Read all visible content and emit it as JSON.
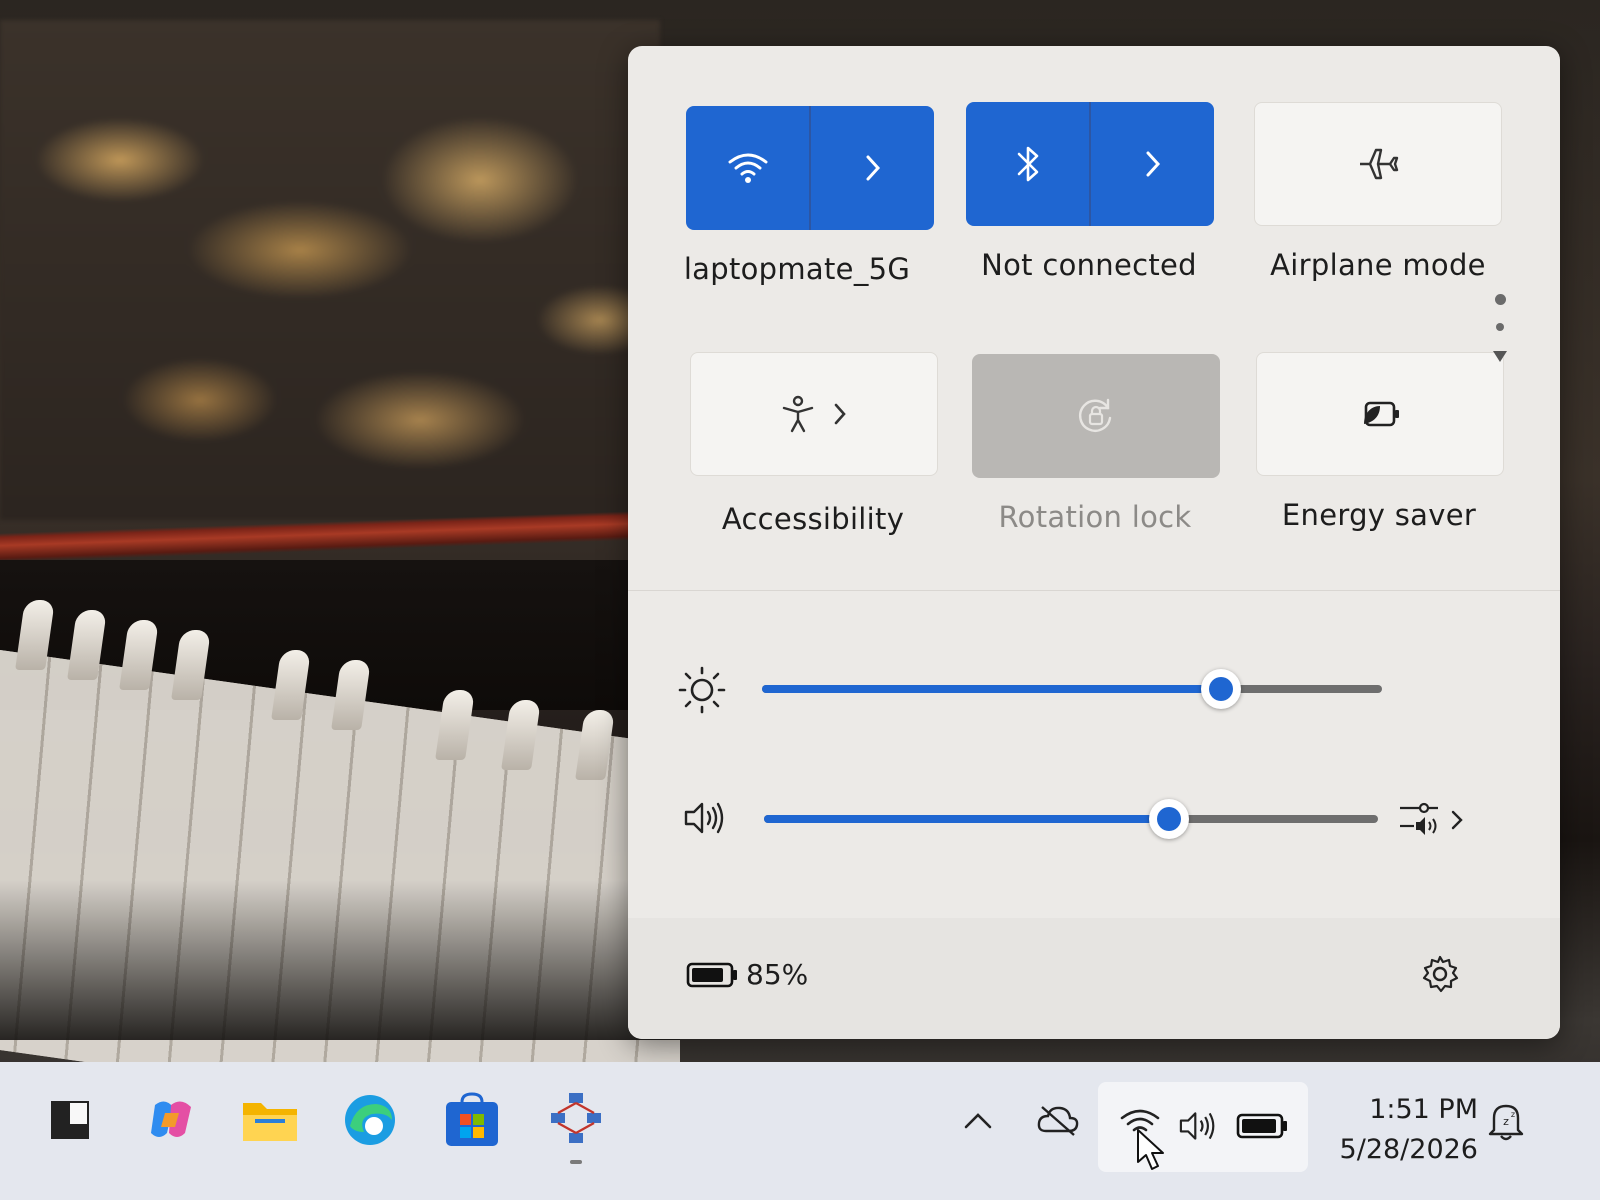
{
  "quick_settings": {
    "tiles": [
      {
        "id": "wifi",
        "label": "laptopmate_5G",
        "state": "on",
        "icon": "wifi-icon",
        "has_chevron": true
      },
      {
        "id": "bluetooth",
        "label": "Not connected",
        "state": "on",
        "icon": "bluetooth-icon",
        "has_chevron": true
      },
      {
        "id": "airplane",
        "label": "Airplane mode",
        "state": "off",
        "icon": "airplane-icon",
        "has_chevron": false
      },
      {
        "id": "accessibility",
        "label": "Accessibility",
        "state": "off",
        "icon": "accessibility-icon",
        "has_chevron": true
      },
      {
        "id": "rotation",
        "label": "Rotation lock",
        "state": "disabled",
        "icon": "rotation-lock-icon",
        "has_chevron": false
      },
      {
        "id": "energy",
        "label": "Energy saver",
        "state": "off",
        "icon": "energy-saver-icon",
        "has_chevron": false
      }
    ],
    "brightness": {
      "level": 0.74
    },
    "volume": {
      "level": 0.66
    },
    "battery": {
      "percent_label": "85%",
      "level": 0.85
    }
  },
  "taskbar": {
    "apps": [
      "widgets-icon",
      "task-view-icon",
      "copilot-icon",
      "file-explorer-icon",
      "edge-icon",
      "store-icon",
      "network-app-icon"
    ],
    "tray": [
      "show-hidden-icons",
      "cloud-off-icon",
      "wifi-icon",
      "volume-icon",
      "battery-icon"
    ],
    "time": "1:51 PM",
    "date": "5/28/2026",
    "notification_icon": "do-not-disturb-icon"
  },
  "colors": {
    "accent": "#1f66d1",
    "panel": "#eceae7",
    "taskbar": "#e4e7ee"
  }
}
